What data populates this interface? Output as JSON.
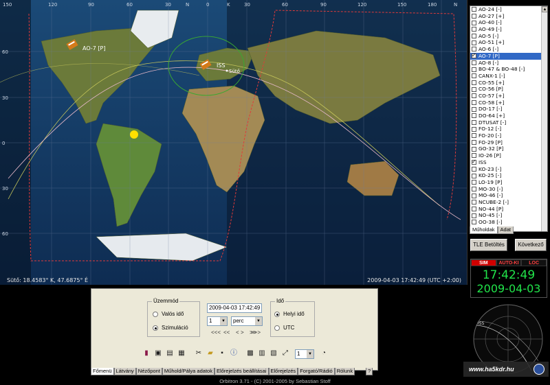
{
  "map": {
    "status_left": "Sütő: 18.4583° K, 47.6875° É",
    "status_right": "2009-04-03 17:42:49 (UTC +2:00)",
    "top_ticks": [
      "150",
      "120",
      "90",
      "60",
      "30",
      "N",
      "0",
      "K",
      "30",
      "60",
      "90",
      "120",
      "150",
      "180",
      "N"
    ],
    "left_ticks": [
      "60",
      "30",
      "0",
      "30",
      "60"
    ],
    "sat_labels": [
      {
        "name": "AO-7 [P]"
      },
      {
        "name": "ISS"
      },
      {
        "name": "Sütő"
      }
    ],
    "colors": {
      "footprint": "#3aa832",
      "track_ao7": "#c4c45a",
      "track_iss": "#e6b8c8",
      "terminator": "#e23a3a",
      "sun": "#ffe000"
    }
  },
  "satellite_list": {
    "items": [
      {
        "label": "AO-24 [-]",
        "checked": false
      },
      {
        "label": "AO-27 [+]",
        "checked": false
      },
      {
        "label": "AO-40 [-]",
        "checked": false
      },
      {
        "label": "AO-49 [-]",
        "checked": false
      },
      {
        "label": "AO-5 [-]",
        "checked": false
      },
      {
        "label": "AO-51 [+]",
        "checked": false
      },
      {
        "label": "AO-6 [-]",
        "checked": false
      },
      {
        "label": "AO-7 [P]",
        "checked": true,
        "selected": true
      },
      {
        "label": "AO-8 [-]",
        "checked": false
      },
      {
        "label": "BO-47 & BO-48 [-]",
        "checked": false
      },
      {
        "label": "CANX-1 [-]",
        "checked": false
      },
      {
        "label": "CO-55 [+]",
        "checked": false
      },
      {
        "label": "CO-56 [P]",
        "checked": false
      },
      {
        "label": "CO-57 [+]",
        "checked": false
      },
      {
        "label": "CO-58 [+]",
        "checked": false
      },
      {
        "label": "DO-17 [-]",
        "checked": false
      },
      {
        "label": "DO-64 [+]",
        "checked": false
      },
      {
        "label": "DTUSAT [-]",
        "checked": false
      },
      {
        "label": "FO-12 [-]",
        "checked": false
      },
      {
        "label": "FO-20 [-]",
        "checked": false
      },
      {
        "label": "FO-29 [P]",
        "checked": false
      },
      {
        "label": "GO-32 [P]",
        "checked": false
      },
      {
        "label": "IO-26 [P]",
        "checked": false
      },
      {
        "label": "ISS",
        "checked": true
      },
      {
        "label": "KO-23 [-]",
        "checked": false
      },
      {
        "label": "KO-25 [-]",
        "checked": false
      },
      {
        "label": "LO-19 [P]",
        "checked": false
      },
      {
        "label": "MO-30 [-]",
        "checked": false
      },
      {
        "label": "MO-46 [-]",
        "checked": false
      },
      {
        "label": "NCUBE-2 [-]",
        "checked": false
      },
      {
        "label": "NO-44 [P]",
        "checked": false
      },
      {
        "label": "NO-45 [-]",
        "checked": false
      },
      {
        "label": "OO-38 [-]",
        "checked": false
      },
      {
        "label": "OSCAR III [-]",
        "checked": false
      },
      {
        "label": "PEHUENSAT 1 [+]",
        "checked": false
      }
    ],
    "tabs": [
      "Műholdak",
      "Adat"
    ]
  },
  "buttons": {
    "tle": "TLE Betöltés",
    "next": "Következő"
  },
  "clock": {
    "modes": [
      "SIM",
      "AUTO-KI",
      "LOC"
    ],
    "time": "17:42:49",
    "date": "2009-04-03"
  },
  "radar": {
    "label": "ISS"
  },
  "watermark": "www.ha5kdr.hu",
  "control": {
    "mode_group": "Üzemmód",
    "mode_realtime": "Valós idő",
    "mode_sim": "Szimuláció",
    "datetime_value": "2009-04-03 17:42:49",
    "step_value": "1",
    "step_unit": "perc",
    "nav_buttons": [
      "<<<",
      "<<",
      "<",
      ">",
      ">>",
      ">>>"
    ],
    "time_group": "Idő",
    "time_local": "Helyi idő",
    "time_utc": "UTC",
    "speed_value": "1",
    "toolbar_icons": [
      "book-icon",
      "camera-icon",
      "panel-icon",
      "window-icon",
      "tools-icon",
      "folder-icon",
      "save-icon",
      "info-icon",
      "grid-icon",
      "layout-icon",
      "multi-icon",
      "fullscreen-icon",
      "clock-icon"
    ]
  },
  "tabs": [
    "Főmenü",
    "Látvány",
    "Nézőpont",
    "Műhold/Pálya adatok",
    "Előrejelzés beállításai",
    "Előrejelzés",
    "Forgató/Rádió",
    "Rólunk"
  ],
  "help_tab": "?",
  "footer": "Orbitron 3.71 - (C) 2001-2005 by Sebastian Stoff"
}
